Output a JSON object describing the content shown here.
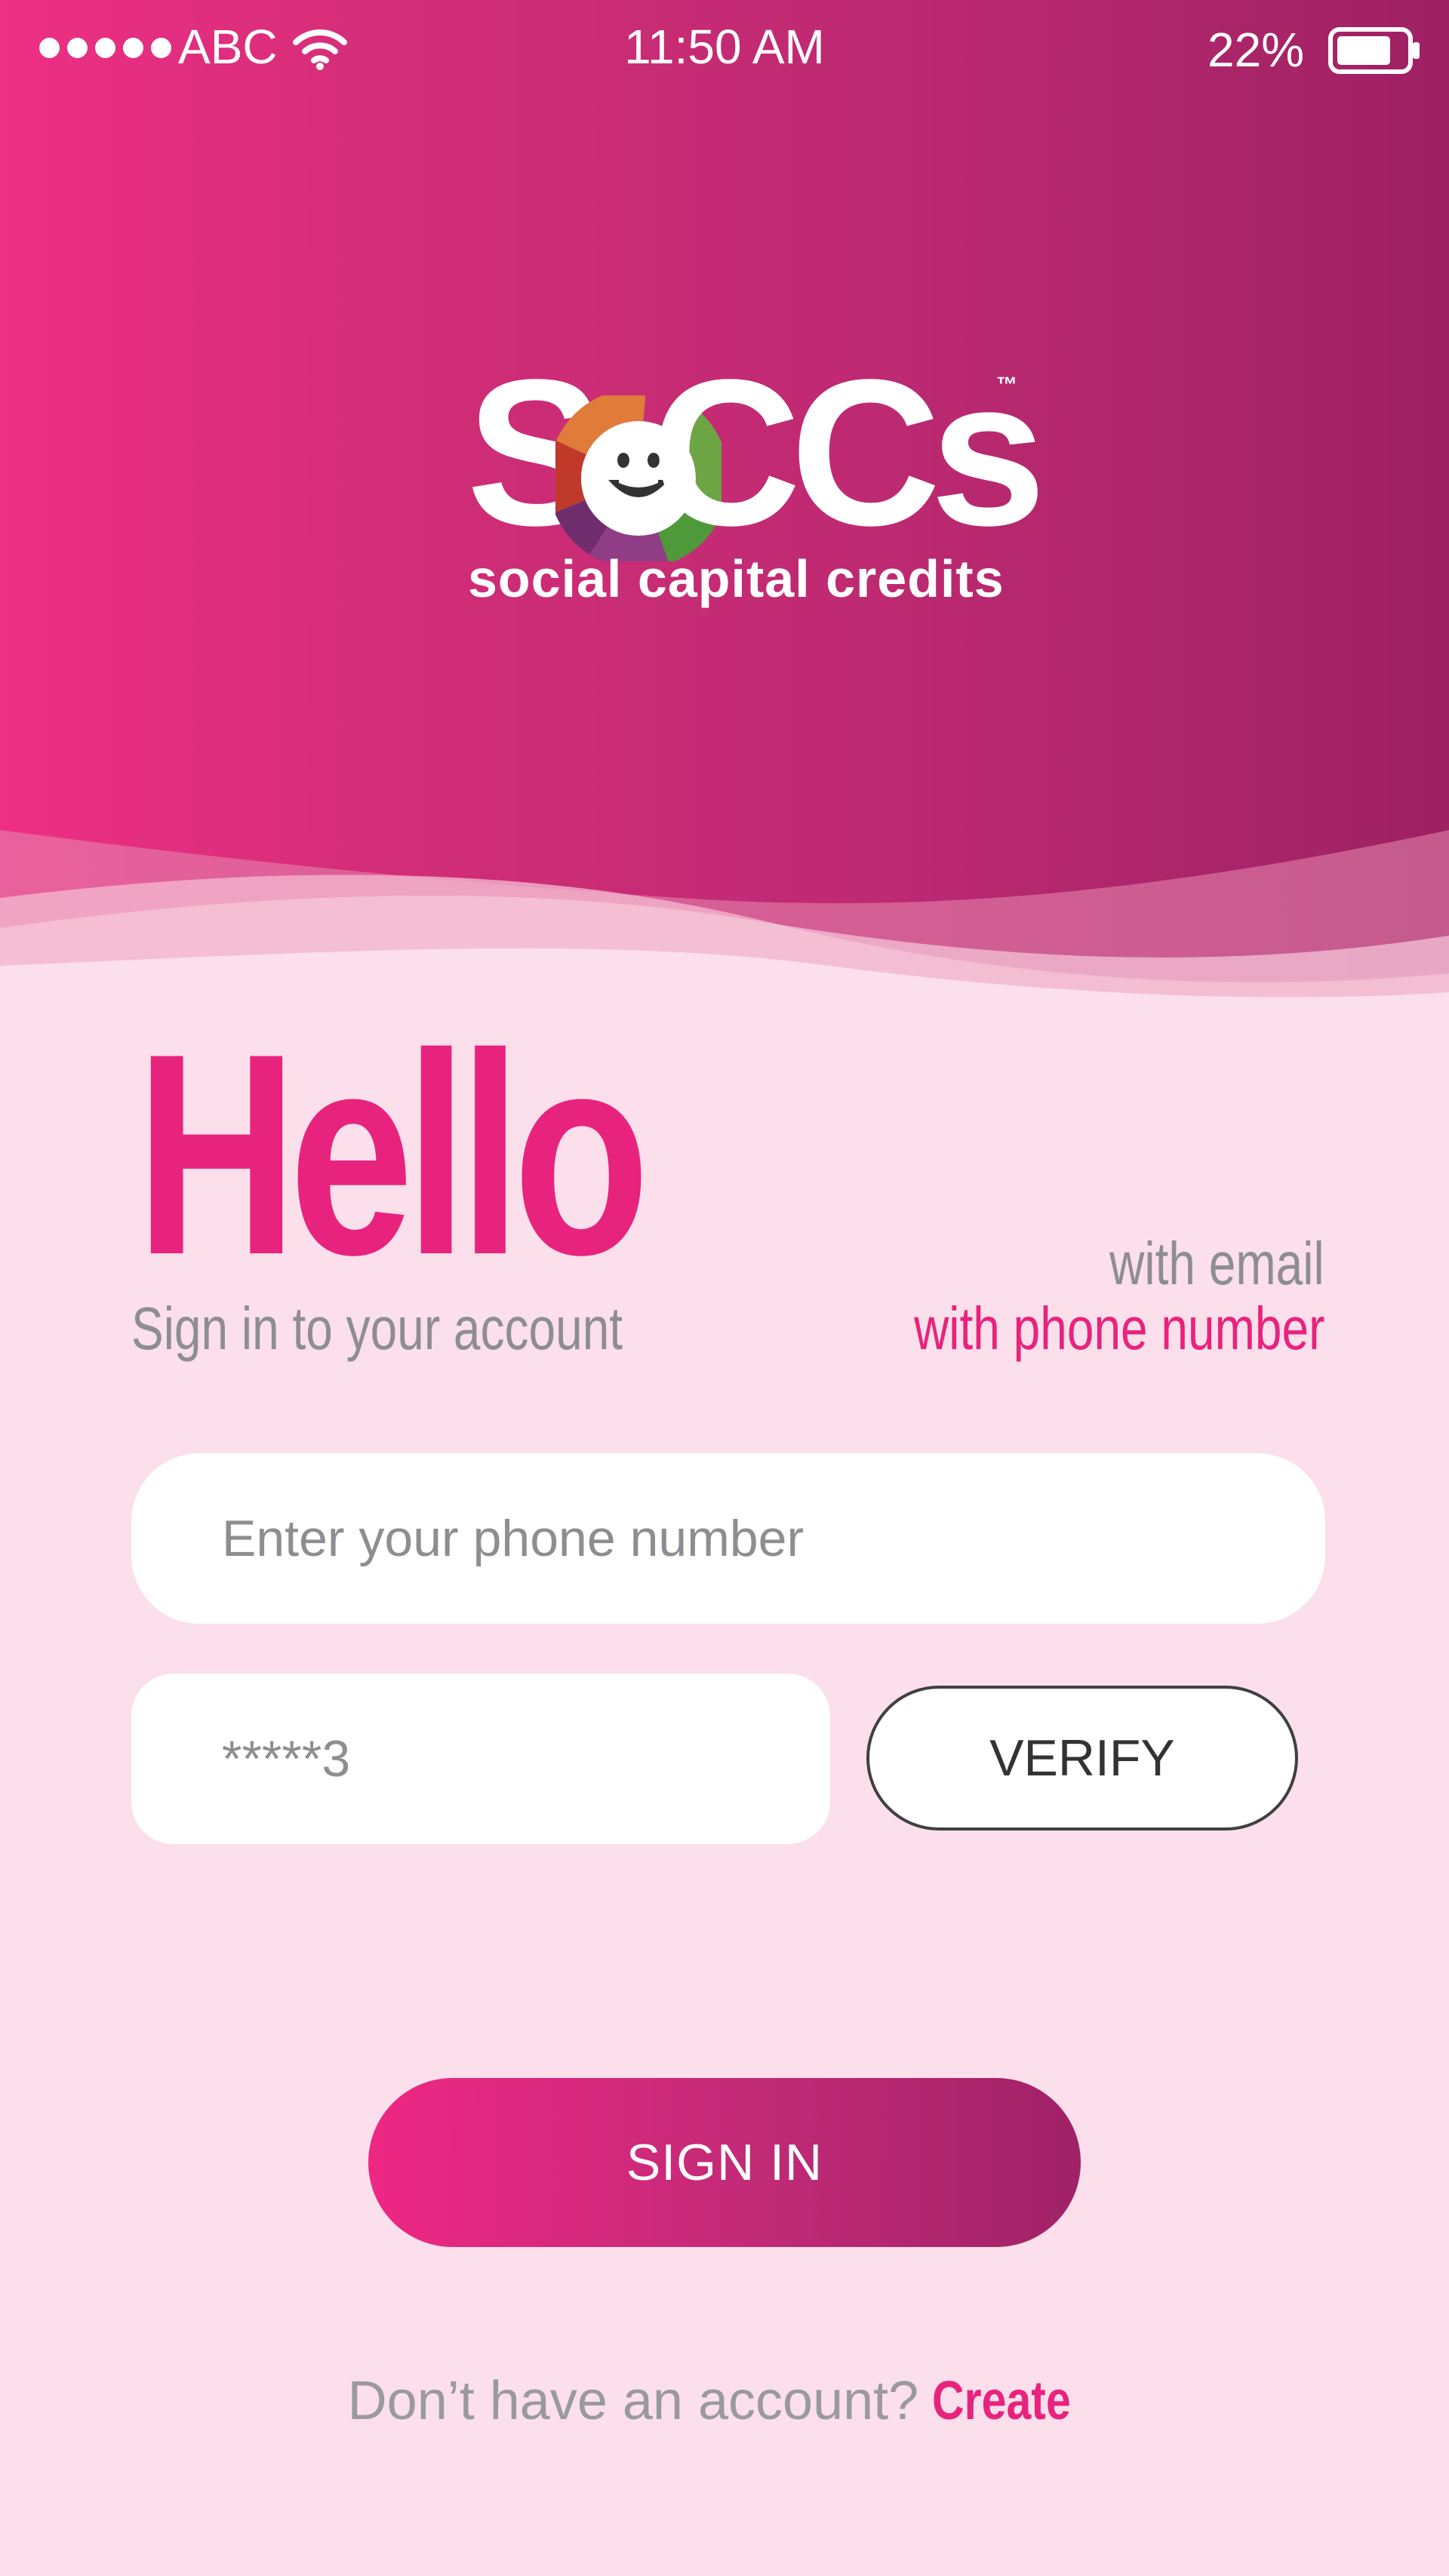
{
  "status_bar": {
    "carrier": "ABC",
    "time": "11:50 AM",
    "battery_percent": "22%",
    "battery_level": 0.22
  },
  "logo": {
    "brand_s": "S",
    "brand_rest": "CCs",
    "trademark": "™",
    "tagline": "social capital credits"
  },
  "login": {
    "title": "Hello",
    "subtitle": "Sign in to your account",
    "option_email": "with email",
    "option_phone": "with phone number",
    "phone_placeholder": "Enter your phone number",
    "code_value": "*****3",
    "verify_label": "VERIFY",
    "signin_label": "SIGN IN",
    "footer_text": "Don’t have an account?",
    "footer_link": "Create"
  },
  "colors": {
    "accent": "#E8237D",
    "header_start": "#EE2F83",
    "header_end": "#9E2163",
    "background": "#FBDFEA"
  }
}
